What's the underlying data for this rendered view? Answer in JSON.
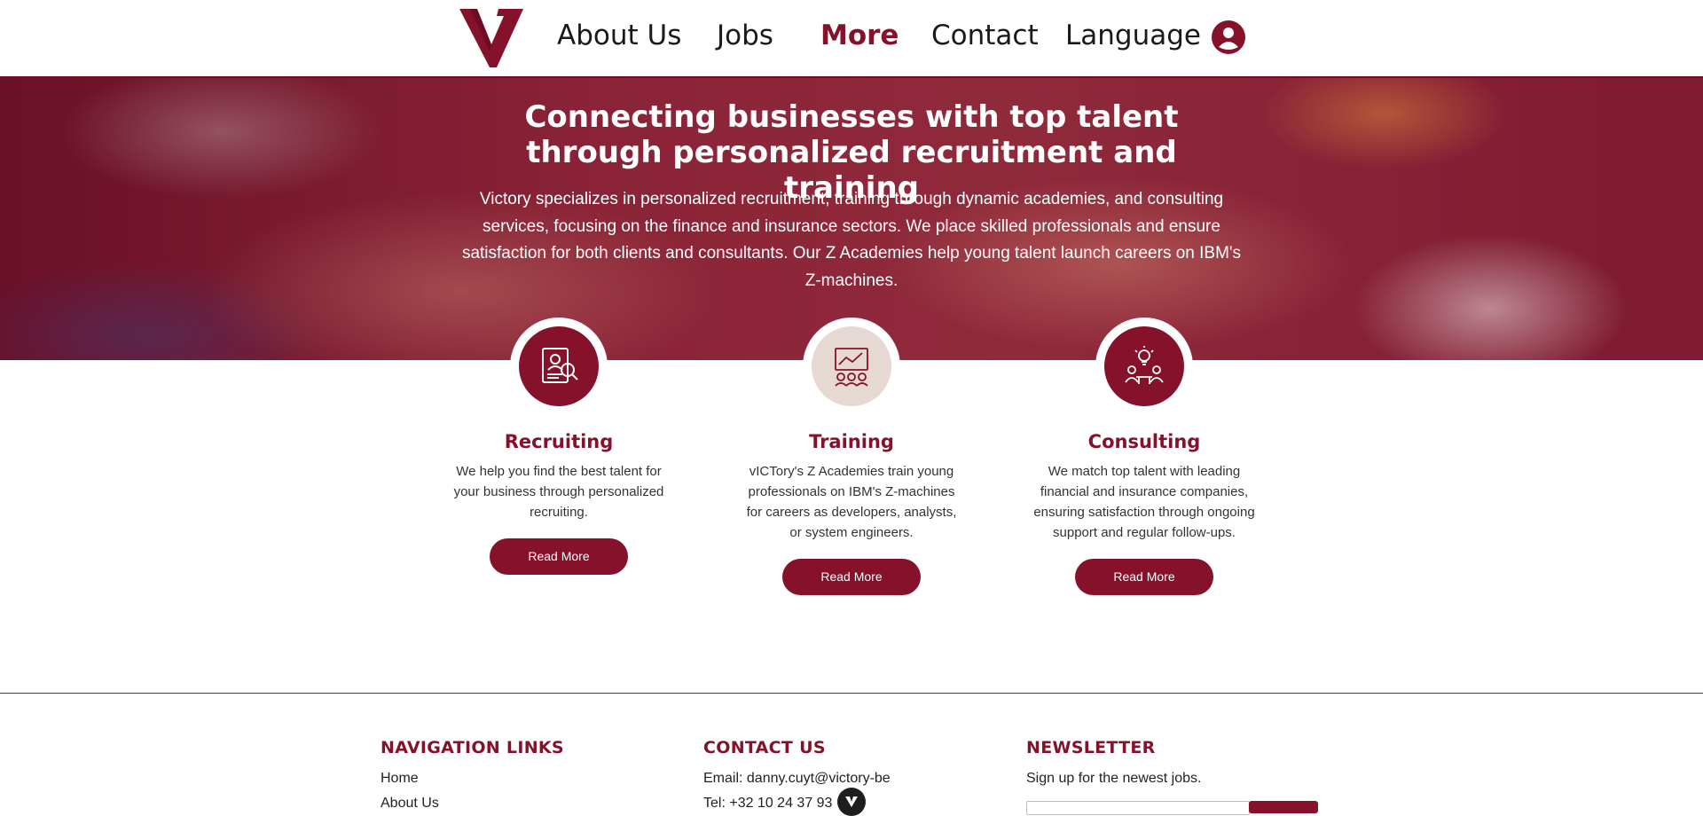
{
  "colors": {
    "brand": "#86112b",
    "brand_light": "#e6d8d3",
    "text": "#222222"
  },
  "header": {
    "logo_icon": "victory-v-logo",
    "nav": [
      {
        "label": "About Us"
      },
      {
        "label": "Jobs"
      },
      {
        "label": "More",
        "active": true
      },
      {
        "label": "Contact"
      },
      {
        "label": "Language"
      }
    ],
    "account_icon": "user-circle-icon"
  },
  "hero": {
    "title": "Connecting businesses with top talent through personalized recruitment and training",
    "text": "Victory specializes in personalized recruitment, training through dynamic academies, and consulting services, focusing on the finance and insurance sectors. We place skilled professionals and ensure satisfaction for both clients and consultants. Our Z Academies help young talent launch careers on IBM's Z-machines."
  },
  "services": [
    {
      "icon": "resume-search-icon",
      "title": "Recruiting",
      "description": "We help you find the best talent for your business through personalized recruiting.",
      "button": "Read More"
    },
    {
      "icon": "presentation-board-icon",
      "title": "Training",
      "description": "vICTory's Z Academies train young professionals on IBM's Z-machines for careers as developers, analysts, or system engineers.",
      "button": "Read More"
    },
    {
      "icon": "idea-meeting-icon",
      "title": "Consulting",
      "description": "We match top talent with leading financial and insurance companies, ensuring satisfaction through ongoing support and regular follow-ups.",
      "button": "Read More"
    }
  ],
  "footer": {
    "nav_heading": "NAVIGATION LINKS",
    "nav_links": [
      "Home",
      "About Us"
    ],
    "contact_heading": "CONTACT US",
    "email": "Email: danny.cuyt@victory-be",
    "phone": "Tel: +32 10 24 37 93",
    "newsletter_heading": "NEWSLETTER",
    "newsletter_text": "Sign up for the newest jobs."
  }
}
